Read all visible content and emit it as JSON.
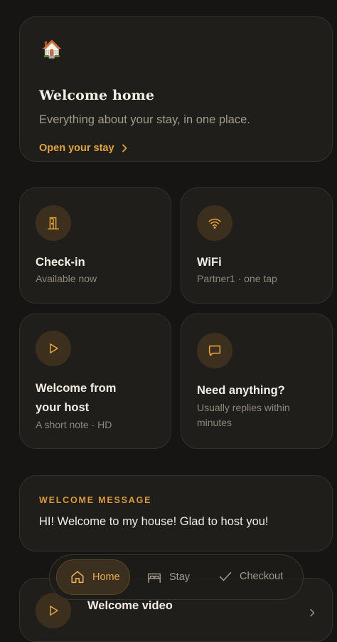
{
  "hero": {
    "emoji": "🏠",
    "title": "Welcome home",
    "subtitle": "Everything about your stay, in one place.",
    "link_label": "Open your stay"
  },
  "tiles": [
    {
      "title": "Check-in",
      "subtitle": "Available now",
      "icon": "door-icon"
    },
    {
      "title": "WiFi",
      "subtitle": "Partner1 · one tap",
      "icon": "wifi-icon"
    },
    {
      "title_line1": "Welcome from",
      "title_line2": "your host",
      "subtitle": "A short note · HD",
      "icon": "play-icon"
    },
    {
      "title": "Need anything?",
      "subtitle_line1": "Usually replies within",
      "subtitle_line2": "minutes",
      "icon": "chat-icon"
    }
  ],
  "welcome_message": {
    "label": "WELCOME MESSAGE",
    "text": "HI! Welcome to my house! Glad to host you!"
  },
  "video_card": {
    "title": "Welcome video",
    "icon": "play-icon"
  },
  "nav": {
    "home": "Home",
    "stay": "Stay",
    "checkout": "Checkout",
    "active": "home"
  },
  "colors": {
    "background": "#171513",
    "card": "#201e1b",
    "accent": "#e3a440",
    "icon_bg": "#3d2f1e"
  }
}
